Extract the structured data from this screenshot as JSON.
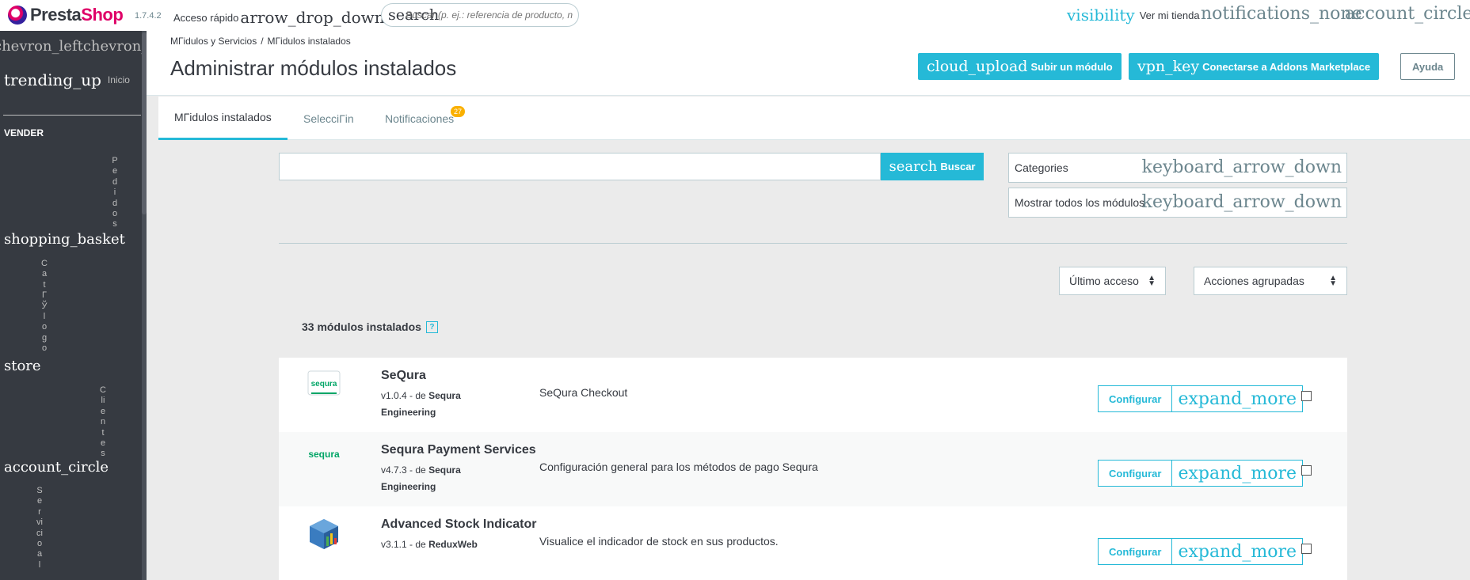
{
  "header": {
    "logo_left": "Presta",
    "logo_right": "Shop",
    "version": "1.7.4.2",
    "quick_access_label": "Acceso rápido",
    "quick_access_icon": "arrow_drop_down",
    "search_icon": "search",
    "search_placeholder": "Buscar (p. ej.: referencia de producto, n",
    "view_shop_icon": "visibility",
    "view_shop_label": "Ver mi tienda",
    "notifications_icon": "notifications_none",
    "account_icon": "account_circle"
  },
  "sidebar": {
    "collapse_icons": "chevron_leftchevron_left",
    "home_icon": "trending_up",
    "home_label": "Inicio",
    "section_label": "VENDER",
    "items": [
      {
        "icon": "shopping_basket",
        "label": "Pedidos"
      },
      {
        "icon": "store",
        "label": "CatГЎlogo"
      },
      {
        "icon": "account_circle",
        "label": "Clientes"
      },
      {
        "icon": "",
        "label": "Servicioal"
      }
    ]
  },
  "page": {
    "breadcrumb": [
      "MГіdulos y Servicios",
      "MГіdulos instalados"
    ],
    "breadcrumb_sep": "/",
    "title": "Administrar módulos instalados",
    "upload_icon": "cloud_upload",
    "upload_label": "Subir un módulo",
    "addons_icon": "vpn_key",
    "addons_label": "Conectarse a Addons Marketplace",
    "help_label": "Ayuda"
  },
  "tabs": [
    {
      "label": "MГіdulos instalados",
      "active": true
    },
    {
      "label": "SelecciГіn",
      "active": false
    },
    {
      "label": "Notificaciones",
      "active": false,
      "badge": "27"
    }
  ],
  "filters": {
    "search_button_icon": "search",
    "search_button_label": "Buscar",
    "categories_label": "Categories",
    "show_all_label": "Mostrar todos los módulos",
    "dropdown_icon": "keyboard_arrow_down",
    "sort_label": "Último acceso",
    "bulk_label": "Acciones agrupadas"
  },
  "summary": {
    "count_text": "33 módulos instalados",
    "help_text": "?"
  },
  "modules": [
    {
      "name": "SeQura",
      "version": "v1.0.4",
      "by": "- de",
      "author": "Sequra Engineering",
      "description": "SeQura Checkout",
      "logo": "sequra-logo"
    },
    {
      "name": "Sequra Payment Services",
      "version": "v4.7.3",
      "by": "- de",
      "author": "Sequra Engineering",
      "description": "Configuración general para los métodos de pago Sequra",
      "logo": "sequra-text-logo"
    },
    {
      "name": "Advanced Stock Indicator",
      "version": "v3.1.1",
      "by": "- de",
      "author": "ReduxWeb",
      "description": "Visualice el indicador de stock en sus productos.",
      "logo": "stock-box-logo"
    }
  ],
  "module_actions": {
    "configure_label": "Configurar",
    "more_icon": "expand_more"
  },
  "logo_text": {
    "sequra_badge": "sequra",
    "sequra_word": "sequra"
  },
  "colors": {
    "accent": "#25b9d7",
    "brand_pink": "#df0067",
    "sidebar": "#363a41",
    "badge": "#fab000"
  }
}
